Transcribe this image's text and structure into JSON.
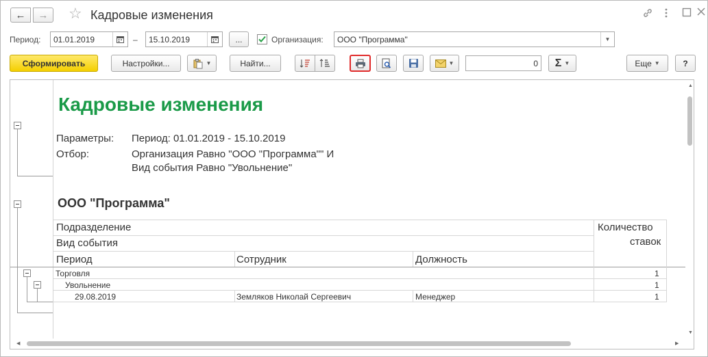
{
  "window": {
    "title": "Кадровые изменения",
    "icons": {
      "back": "arrow-left-icon",
      "forward": "arrow-right-icon",
      "favorite": "star-icon",
      "link": "link-icon",
      "menu": "more-vertical-icon",
      "maximize": "maximize-icon",
      "close": "close-icon"
    }
  },
  "params": {
    "period_label": "Период:",
    "date_from": "01.01.2019",
    "dash": "–",
    "date_to": "15.10.2019",
    "more_label": "...",
    "org_checked": true,
    "org_label": "Организация:",
    "org_value": "ООО \"Программа\""
  },
  "toolbar": {
    "generate_label": "Сформировать",
    "settings_label": "Настройки...",
    "find_label": "Найти...",
    "sum_value": "0",
    "more_label": "Еще",
    "help_label": "?",
    "sigma": "Σ"
  },
  "report": {
    "title": "Кадровые изменения",
    "params_label": "Параметры:",
    "params_value": "Период: 01.01.2019 - 15.10.2019",
    "filter_label": "Отбор:",
    "filter_line1": "Организация Равно \"ООО \"Программа\"\" И",
    "filter_line2": "Вид события Равно \"Увольнение\"",
    "org_title": "ООО \"Программа\"",
    "headers": {
      "division": "Подразделение",
      "event_type": "Вид события",
      "period": "Период",
      "employee": "Сотрудник",
      "position": "Должность",
      "count_line1": "Количество",
      "count_line2": "ставок"
    },
    "rows": [
      {
        "label": "Торговля",
        "employee": "",
        "position": "",
        "count": "1"
      },
      {
        "label": "Увольнение",
        "employee": "",
        "position": "",
        "count": "1"
      },
      {
        "label": "29.08.2019",
        "employee": "Земляков Николай Сергеевич",
        "position": "Менеджер",
        "count": "1"
      }
    ]
  },
  "colors": {
    "accent_title": "#1a9a48",
    "primary_button": "#f4cf00",
    "highlight_border": "#e02a2a"
  }
}
